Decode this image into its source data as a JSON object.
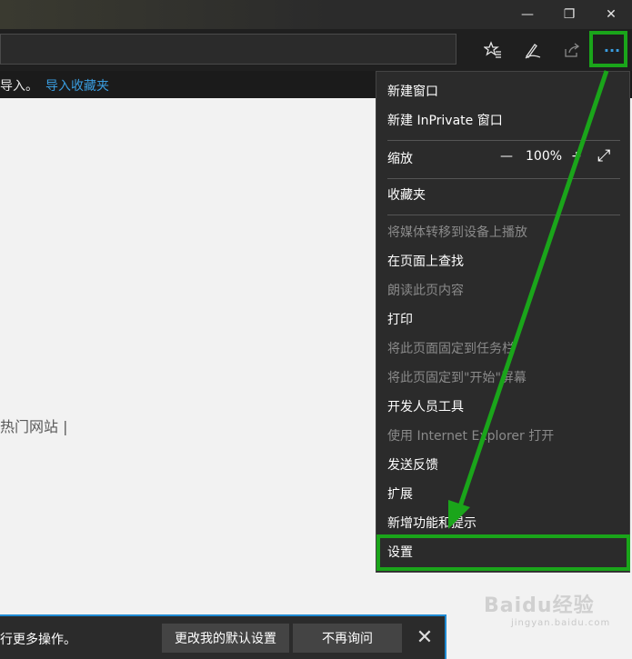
{
  "window_controls": {
    "minimize": "—",
    "restore": "❐",
    "close": "✕"
  },
  "toolbar": {
    "favorites_icon": "star-list-icon",
    "notes_icon": "pen-icon",
    "share_icon": "share-icon",
    "more": "···"
  },
  "favbar": {
    "text": "导入。",
    "link": "导入收藏夹"
  },
  "content": {
    "hot_sites": "热门网站 |"
  },
  "menu": {
    "new_window": "新建窗口",
    "new_inprivate": "新建 InPrivate 窗口",
    "zoom_label": "缩放",
    "zoom_minus": "—",
    "zoom_value": "100%",
    "zoom_plus": "+",
    "zoom_fullscreen": "⤢",
    "favorites": "收藏夹",
    "cast_media": "将媒体转移到设备上播放",
    "find_on_page": "在页面上查找",
    "read_aloud": "朗读此页内容",
    "print": "打印",
    "pin_taskbar": "将此页面固定到任务栏",
    "pin_start": "将此页固定到\"开始\"屏幕",
    "dev_tools": "开发人员工具",
    "open_ie": "使用 Internet Explorer 打开",
    "feedback": "发送反馈",
    "extensions": "扩展",
    "whats_new": "新增功能和提示",
    "settings": "设置"
  },
  "notification": {
    "message": "行更多操作。",
    "change_default": "更改我的默认设置",
    "dont_ask": "不再询问",
    "close": "✕"
  },
  "watermark": {
    "text": "Baidu经验",
    "sub": "jingyan.baidu.com"
  },
  "colors": {
    "highlight": "#1aa51a",
    "link": "#3a9de0",
    "accent": "#1e8ad2"
  }
}
